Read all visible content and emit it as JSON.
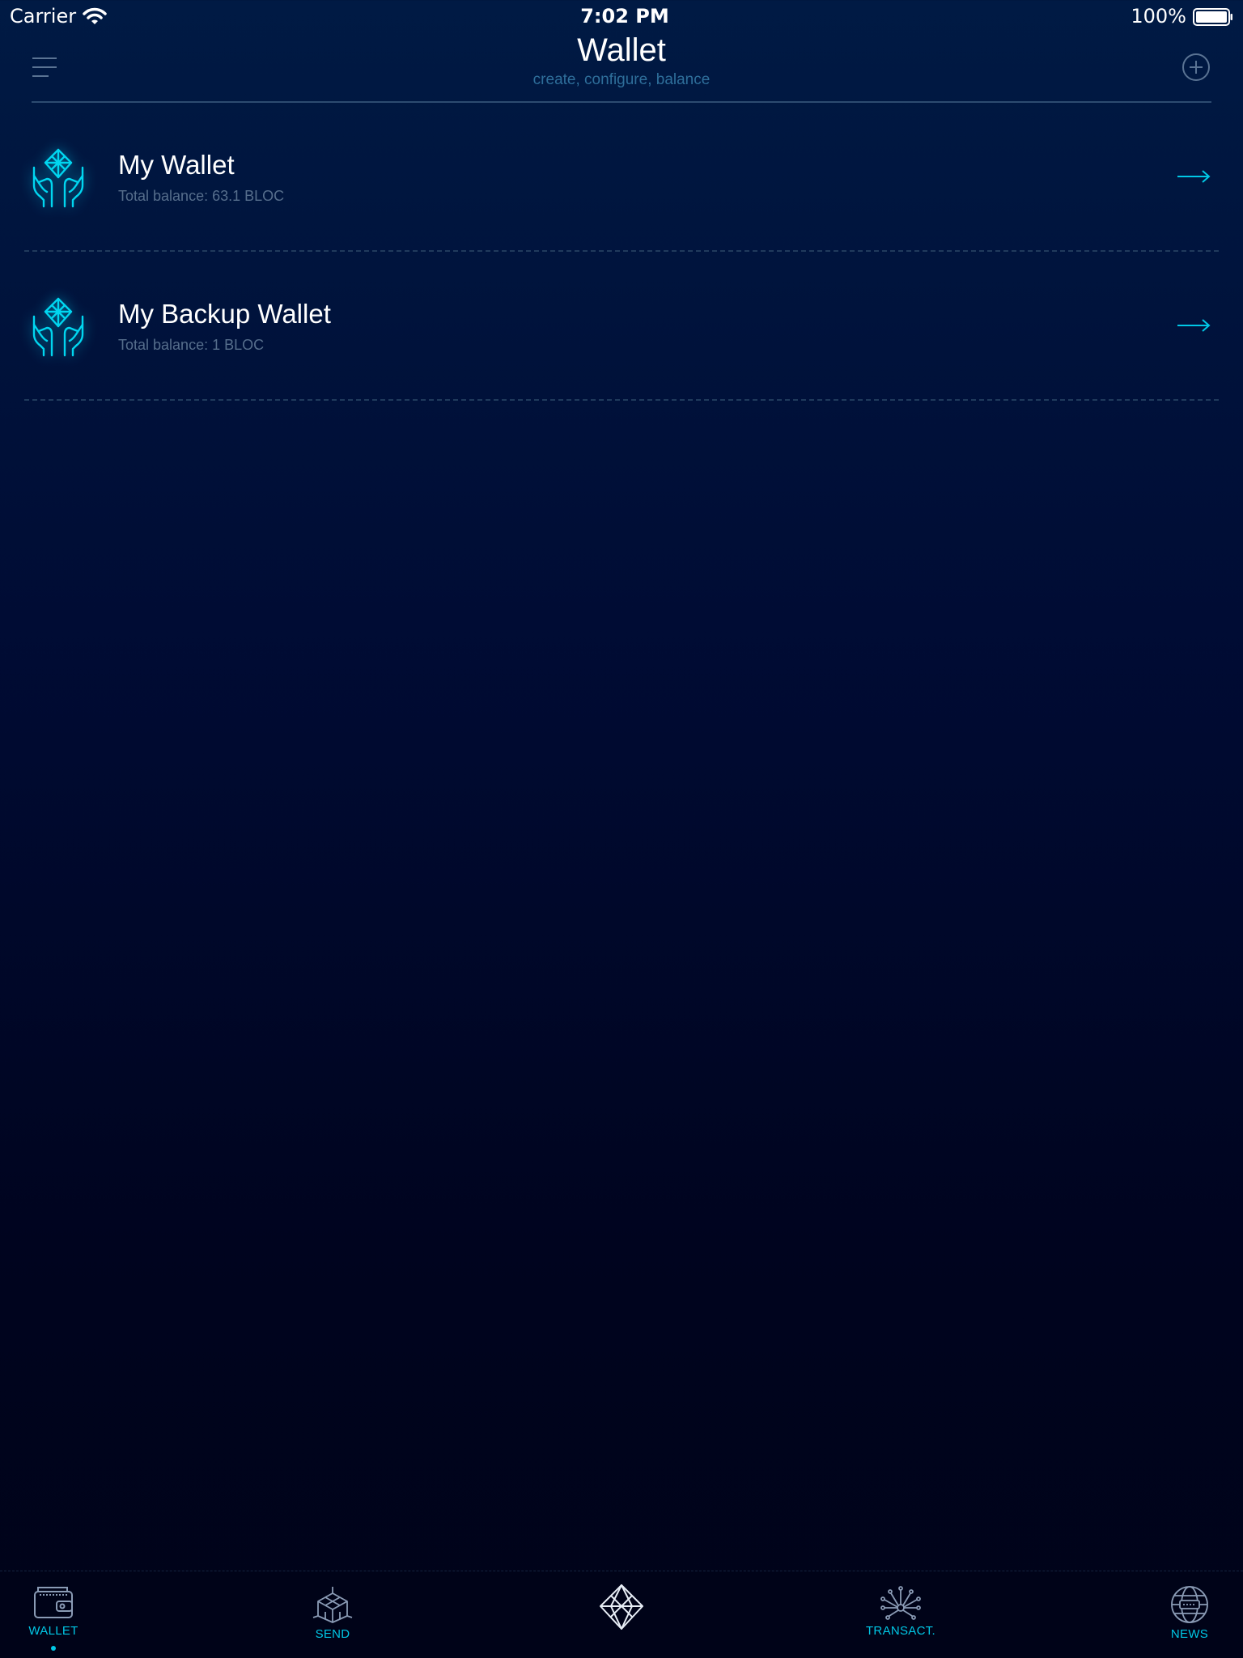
{
  "status_bar": {
    "carrier": "Carrier",
    "time": "7:02 PM",
    "battery": "100%"
  },
  "header": {
    "title": "Wallet",
    "subtitle": "create, configure, balance",
    "menu_icon": "hamburger-menu-icon",
    "add_icon": "plus-circle-icon"
  },
  "wallets": [
    {
      "name": "My Wallet",
      "balance": "Total balance: 63.1 BLOC",
      "icon": "hands-holding-crystal-icon"
    },
    {
      "name": "My Backup Wallet",
      "balance": "Total balance: 1 BLOC",
      "icon": "hands-holding-crystal-icon"
    }
  ],
  "tab_bar": {
    "tabs": [
      {
        "label": "WALLET",
        "icon": "wallet-icon",
        "active": true
      },
      {
        "label": "SEND",
        "icon": "send-cube-icon",
        "active": false
      },
      {
        "label": "",
        "icon": "crystal-logo-icon",
        "active": false
      },
      {
        "label": "TRANSACT.",
        "icon": "transactions-network-icon",
        "active": false
      },
      {
        "label": "NEWS",
        "icon": "globe-news-icon",
        "active": false
      }
    ]
  },
  "colors": {
    "accent": "#00c8e6",
    "background_top": "#001a44",
    "background_bottom": "#000319",
    "subtitle": "#2e6e9a",
    "balance_text": "#566e8c"
  }
}
